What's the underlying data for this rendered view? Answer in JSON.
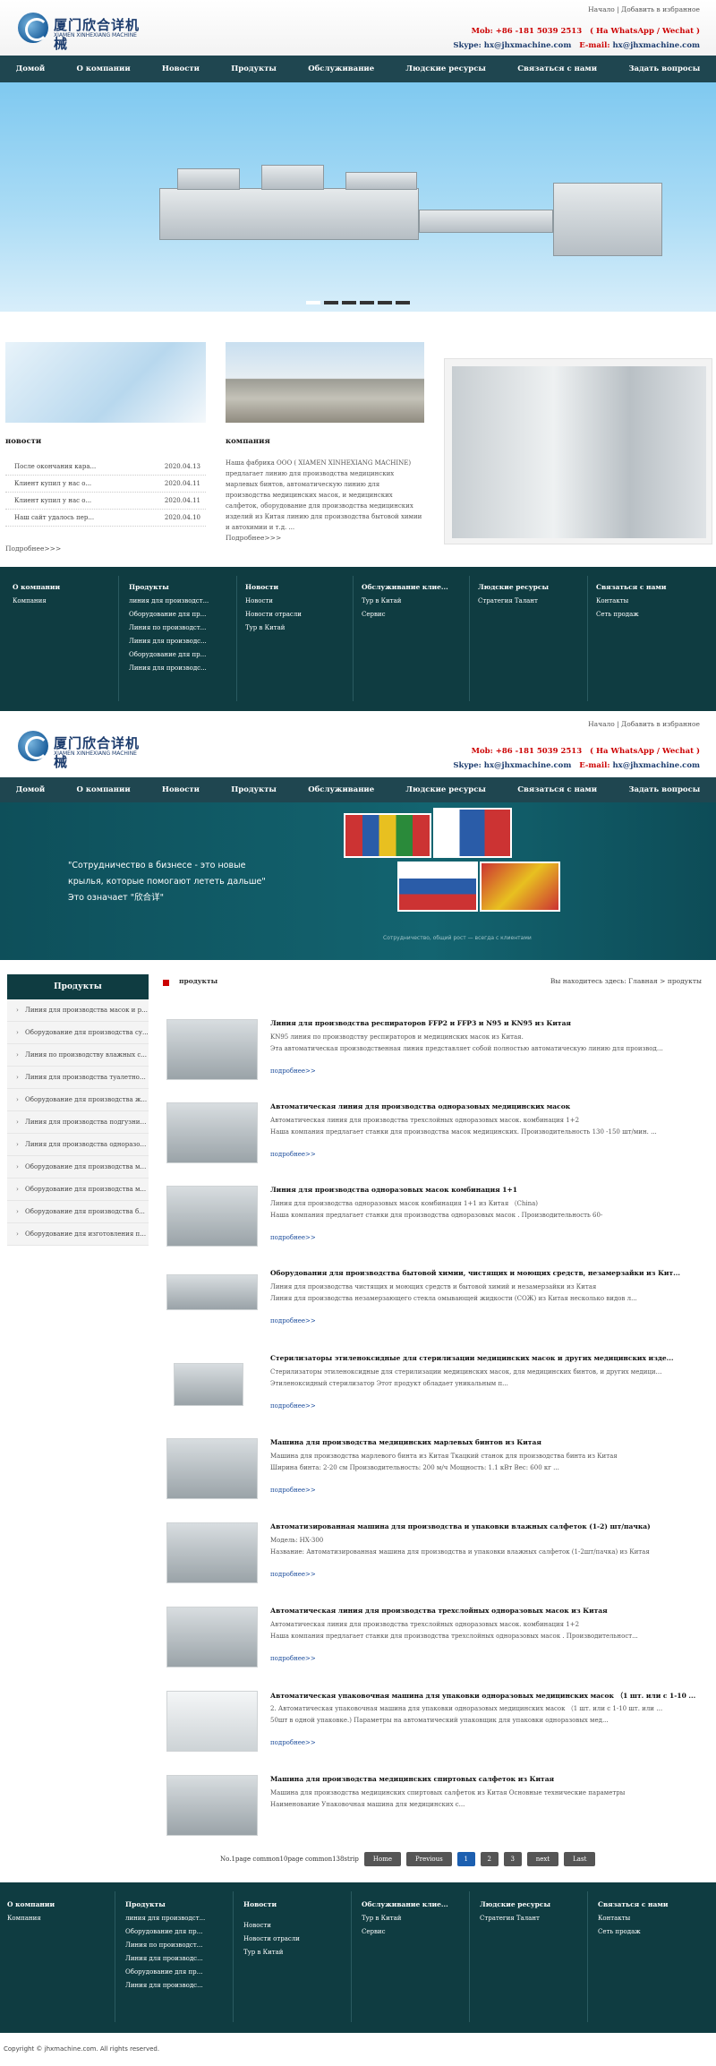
{
  "header": {
    "top_links": [
      "Начало",
      "Добавить в избранное"
    ],
    "logo_cn": "厦门欣合详机械",
    "logo_en": "XIAMEN XINHEXIANG MACHINE",
    "mob_label": "Mob:",
    "mob_value": "+86 -181 5039 2513",
    "mob_note": "( На WhatsApp / Wechat )",
    "skype_label": "Skype:",
    "skype_value": "hx@jhxmachine.com",
    "email_label": "E-mail:",
    "email_value": "hx@jhxmachine.com"
  },
  "nav": [
    "Домой",
    "О компании",
    "Новости",
    "Продукты",
    "Обслуживание",
    "Людские ресурсы",
    "Связаться с нами",
    "Задать вопросы"
  ],
  "home": {
    "news_title": "новости",
    "news_items": [
      {
        "title": "После окончания кара...",
        "date": "2020.04.13"
      },
      {
        "title": "Клиент купил у нас о...",
        "date": "2020.04.11"
      },
      {
        "title": "Клиент купил у нас о...",
        "date": "2020.04.11"
      },
      {
        "title": "Наш сайт удалось пер...",
        "date": "2020.04.10"
      }
    ],
    "news_more": "Подробнее>>>",
    "company_title": "компания",
    "company_text": "Наша фабрика ООО ( XIAMEN XINHEXIANG MACHINE) предлагает линию для производства медицинских марлевых бинтов, автоматическую линию для производства медицинских масок, и медицинских салфеток, оборудование для производства медицинских изделий из Китая линию для производства бытовой химии и автохимии и т.д. ...",
    "company_more": "Подробнее>>>"
  },
  "footer": [
    {
      "title": "О компании",
      "items": [
        "Компания"
      ]
    },
    {
      "title": "Продукты",
      "items": [
        "линия для производст...",
        "Оборудование для пр...",
        "Линия по производст...",
        "Линия для производс...",
        "Оборудование для пр...",
        "Линия для производс..."
      ]
    },
    {
      "title": "Новости",
      "items": [
        "Новости",
        "Новости отрасли",
        "Тур в Китай"
      ]
    },
    {
      "title": "Обслуживание клие...",
      "items": [
        "Тур в Китай",
        "Сервис"
      ]
    },
    {
      "title": "Людские ресурсы",
      "items": [
        "Стратегия Талант"
      ]
    },
    {
      "title": "Связаться с нами",
      "items": [
        "Контакты",
        "Сеть продаж"
      ]
    }
  ],
  "banner2": {
    "slogan": [
      "\"Сотрудничество в бизнесе - это новые",
      "крылья, которые помогают лететь дальше\"",
      "Это означает \"欣合详\""
    ],
    "caption": "Сотрудничество, общий рост — всегда с клиентами"
  },
  "sidebar": {
    "title": "Продукты",
    "items": [
      "Линия для производства масок и ре...",
      "Оборудование для производства су...",
      "Линия по производству влажных с...",
      "Линия для производства туалетной...",
      "Оборудование для производства ж...",
      "Линия для производства подгузник...",
      "Линия для производства одноразов...",
      "Оборудование для производства ме...",
      "Оборудование для производства м...",
      "Оборудование для производства б...",
      "Оборудование для изготовления пл..."
    ]
  },
  "crumb": {
    "label": "продукты",
    "location": "Вы находитесь здесь:",
    "path": "Главная > продукты"
  },
  "products": [
    {
      "title": "Линия для производства респираторов FFP2 и FFP3 и N95 и KN95 из Китая",
      "lines": [
        "KN95 линия по производству респираторов и медицинских масок из Китая.",
        "Эта автоматическая производственная линия представляет собой полностью автоматическую линию для производства пре"
      ],
      "more": "подробнее>>"
    },
    {
      "title": "Автоматическая линия для производства одноразовых медицинских масок",
      "lines": [
        " Автоматическая линия для производства трехслойных одноразовых масок. комбинация 1+2",
        "Наша компания предлагает станки для производства масок медицинских. Производительность 130 -150 шт/мин. ..."
      ],
      "more": "подробнее>>"
    },
    {
      "title": "Линия для производства одноразовых масок комбинация 1+1",
      "lines": [
        "Линия для производства одноразовых масок комбинация 1+1 из Китая （China)",
        "Наша компания предлагает станки для производства одноразовых масок . Производительность 60-"
      ],
      "more": "подробнее>>"
    },
    {
      "title": "Оборудования для производства бытовой химии, чистящих и моющих средств, незамерзайки из Кит...",
      "lines": [
        "Линия для производства чистящих и моющих средств и бытовой химий и незамерзайки из Китая",
        "Линия для производства незамерзающего стекла омывающей жидкости (СОЖ) из Китая несколько видов л..."
      ],
      "more": "подробнее>>"
    },
    {
      "title": "Стерилизаторы этиленоксидные для стерилизации медицинских масок и других медицинских изде...",
      "lines": [
        "Стерилизаторы этиленоксидные для стерилизации медицинских масок, для медицинских бинтов, и других медицинских",
        "   Этиленоксидный стерилизатор Этот продукт обладает уникальным п..."
      ],
      "more": "подробнее>>"
    },
    {
      "title": "Машина для производства медицинских марлевых бинтов из Китая",
      "lines": [
        "Машина для производства марлевого бинта из Китая   Ткацкий станок для производства бинта из Китая",
        "Ширина бинта: 2-20 см  Производительность: 200 м/ч  Мощность: 1.1 кВт  Вес: 600 кг   ..."
      ],
      "more": "подробнее>>"
    },
    {
      "title": "Автоматизированная машина для производства и упаковки влажных салфеток (1-2) шт/пачка)",
      "lines": [
        "Модель: HX-300",
        "Название: Автоматизированная машина для производства и упаковки влажных салфеток (1-2шт/пачка)  из Китая"
      ],
      "more": "подробнее>>"
    },
    {
      "title": "Автоматическая линия для производства трехслойных одноразовых масок из Китая",
      "lines": [
        " Автоматическая линия для производства трехслойных одноразовых масок. комбинация 1+2",
        "Наша компания предлагает станки для производства трехслойных одноразовых масок . Производительност..."
      ],
      "more": "подробнее>>"
    },
    {
      "title": "Автоматическая упаковочная машина для упаковки одноразовых медицинских масок  （1 шт. или с 1-10 ...",
      "lines": [
        "2. Автоматическая упаковочная машина для упаковки одноразовых медицинских масок  （1 шт. или с 1-10 шт. или с 20-",
        "50шт в одной упаковке.)    Параметры на автоматический упаковщик для упаковки одноразовых мед..."
      ],
      "more": "подробнее>>"
    },
    {
      "title": "Машина для производства медицинских спиртовых салфеток из Китая",
      "lines": [
        "Машина для производства медицинских спиртовых салфеток из Китая  Основные технические параметры",
        "Наименование  Упаковочная  машина для медицинских с..."
      ],
      "more": "подробнее>>"
    }
  ],
  "pager": {
    "info": "No.1page common10page common138strip",
    "home": "Home",
    "prev": "Previous",
    "pages": [
      "1",
      "2",
      "3"
    ],
    "current": "1",
    "next": "next",
    "last": "Last"
  },
  "copyright": "Copyright © jhxmachine.com. All rights reserved.",
  "colors": {
    "nav_bg": "#1f4650",
    "footer_bg": "#0f3c41",
    "accent_red": "#cc0000",
    "link_blue": "#1c4d9c"
  }
}
